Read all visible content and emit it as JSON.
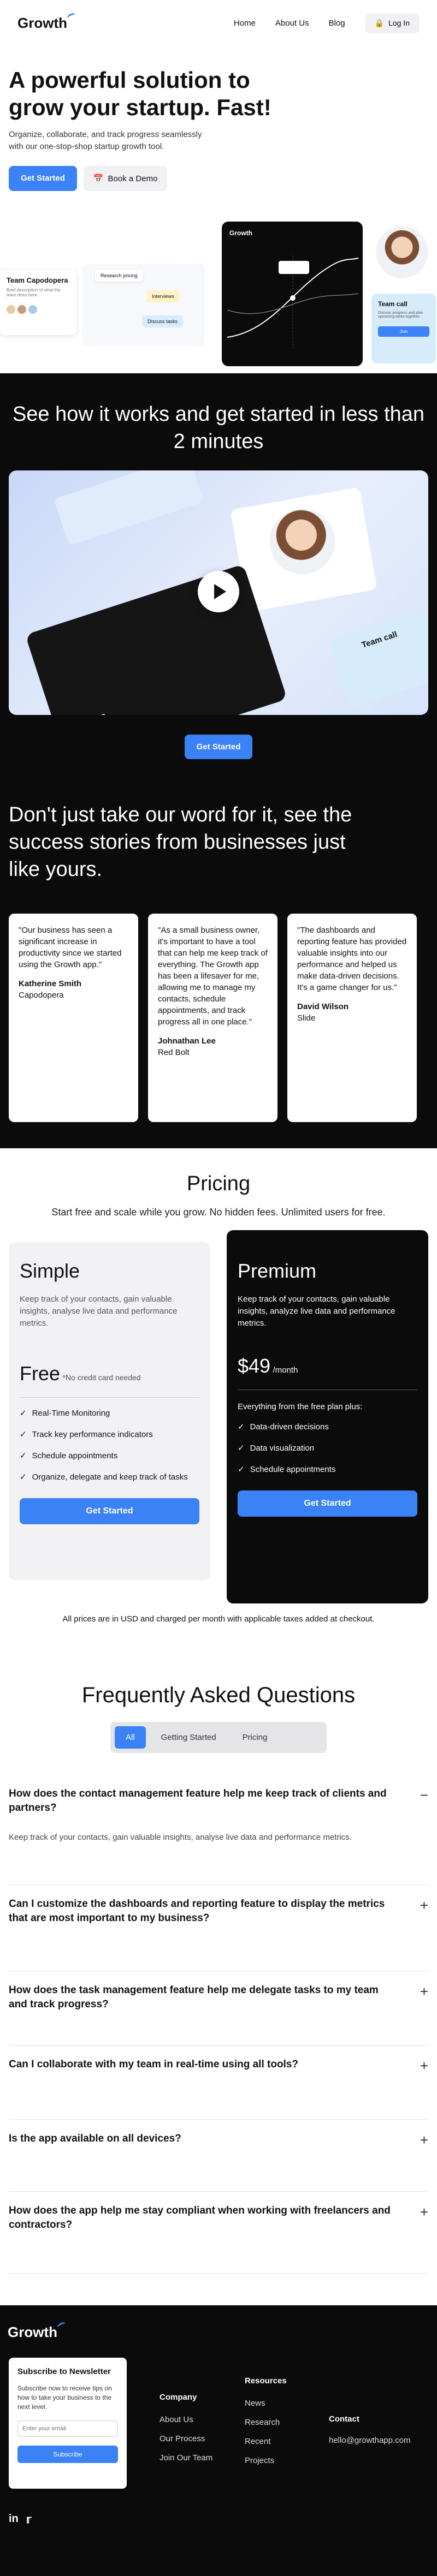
{
  "nav": {
    "logo": "Growth",
    "links": [
      "Home",
      "About Us",
      "Blog"
    ],
    "login": "Log In"
  },
  "hero": {
    "title": "A powerful solution to grow your startup. Fast!",
    "desc": "Organize, collaborate, and track progress seamlessly with our one-stop-shop startup growth tool.",
    "cta": "Get Started",
    "demo": "Book a Demo",
    "team_card_title": "Team Capodopera",
    "team_card_desc": "Brief description of what the team does here.",
    "dash_label": "Growth",
    "call_label": "Team call",
    "call_desc": "Discuss progress and plan upcoming tasks together.",
    "call_btn": "Join",
    "task_labels": [
      "Research pricing",
      "Interviews",
      "Discuss tasks"
    ]
  },
  "how": {
    "title": "See how it works and get started in less than 2 minutes",
    "cta": "Get Started",
    "video_labels": [
      "Sales",
      "Team call"
    ]
  },
  "stories": {
    "title": "Don't just take our word for it, see the success stories from businesses just like yours.",
    "items": [
      {
        "quote": "\"Our business has seen a significant increase in productivity since we started using the Growth app.\"",
        "name": "Katherine Smith",
        "company": "Capodopera"
      },
      {
        "quote": "\"As a small business owner, it's important to have a tool that can help me keep track of everything. The Growth app has been a lifesaver for me, allowing me to manage my contacts, schedule appointments, and track progress all in one place.\"",
        "name": "Johnathan Lee",
        "company": "Red Bolt"
      },
      {
        "quote": "\"The dashboards and reporting feature has provided valuable insights into our performance and helped us make data-driven decisions. It's a game changer for us.\"",
        "name": "David Wilson",
        "company": "Slide"
      }
    ]
  },
  "pricing": {
    "title": "Pricing",
    "sub": "Start free and scale while you grow. No hidden fees. Unlimited users for free.",
    "simple": {
      "name": "Simple",
      "desc": "Keep track of your contacts, gain valuable insights, analyse live data and performance metrics.",
      "price": "Free",
      "note": "*No credit card needed",
      "features": [
        "Real-Time Monitoring",
        "Track key performance indicators",
        "Schedule appointments",
        "Organize, delegate and keep track of tasks"
      ],
      "cta": "Get Started"
    },
    "premium": {
      "name": "Premium",
      "desc": "Keep track of your contacts, gain valuable insights, analyze live data and performance metrics.",
      "price": "$49",
      "per": "/month",
      "plus": "Everything from the free plan plus:",
      "features": [
        "Data-driven decisions",
        "Data visualization",
        "Schedule appointments"
      ],
      "cta": "Get Started"
    },
    "footnote": "All prices are in USD and charged per month with applicable taxes added at checkout."
  },
  "faq": {
    "title": "Frequently Asked Questions",
    "tabs": [
      "All",
      "Getting Started",
      "Pricing"
    ],
    "items": [
      {
        "q": "How does the contact management feature help me keep track of clients and partners?",
        "a": "Keep track of your contacts, gain valuable insights, analyse live data and performance metrics.",
        "open": true
      },
      {
        "q": "Can I customize the dashboards and reporting feature to display the metrics that are most important to my business?"
      },
      {
        "q": "How does the task management feature help me delegate tasks to my team and track progress?"
      },
      {
        "q": "Can I collaborate with my team in real-time using all tools?"
      },
      {
        "q": "Is the app available on all devices?"
      },
      {
        "q": "How does the app help me stay compliant when working with freelancers and contractors?"
      }
    ]
  },
  "footer": {
    "logo": "Growth",
    "newsletter_title": "Subscribe to Newsletter",
    "newsletter_desc": "Subscribe now to receive tips on how to take your business to the next level.",
    "email_placeholder": "Enter your email",
    "subscribe": "Subscribe",
    "company_title": "Company",
    "company": [
      "About Us",
      "Our Process",
      "Join Our Team"
    ],
    "resources_title": "Resources",
    "resources": [
      "News",
      "Research",
      "Recent",
      "Projects"
    ],
    "contact_title": "Contact",
    "email": "hello@growthapp.com"
  },
  "colors": {
    "accent": "#3b82f6",
    "dark": "#0b0b0b"
  }
}
